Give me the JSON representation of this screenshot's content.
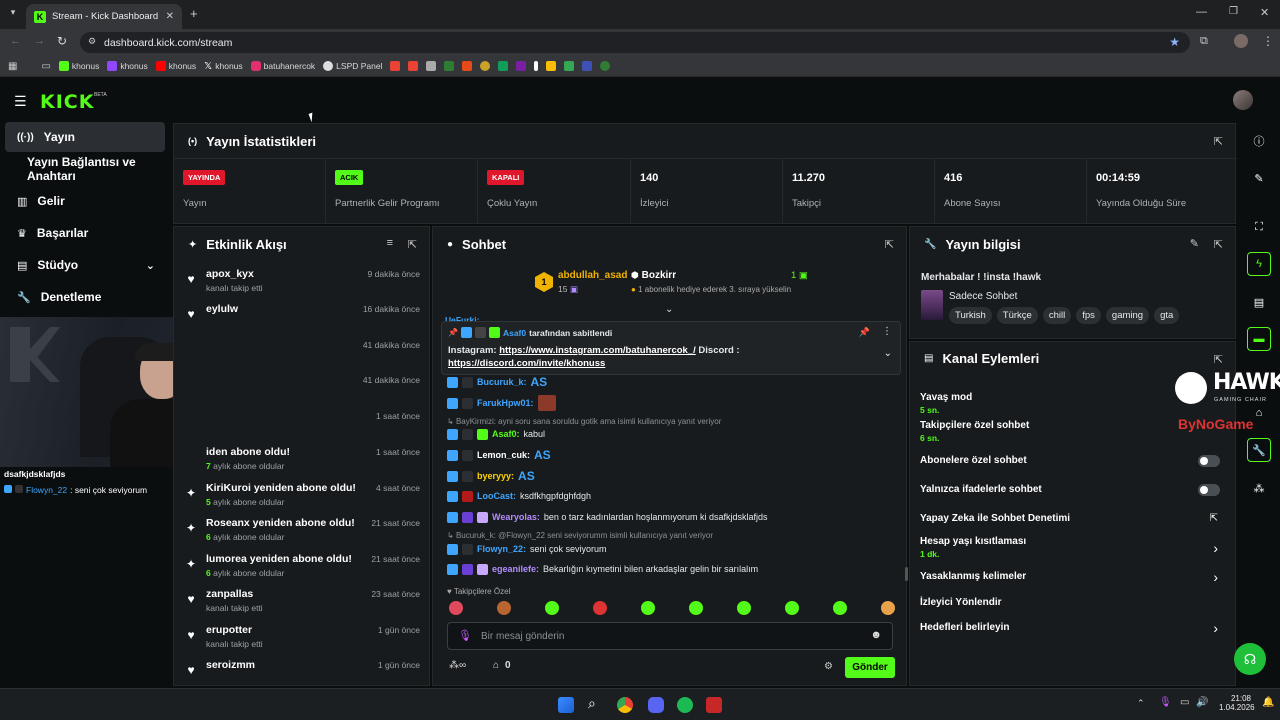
{
  "browser": {
    "tab_title": "Stream - Kick Dashboard",
    "url": "dashboard.kick.com/stream",
    "bookmarks": [
      {
        "label": "khonus",
        "color": "#53fc18"
      },
      {
        "label": "khonus",
        "color": "#9146ff"
      },
      {
        "label": "khonus",
        "color": "#ff0000"
      },
      {
        "label": "khonus",
        "color": "#ffffff"
      },
      {
        "label": "batuhanercok",
        "color": "#e1306c"
      },
      {
        "label": "LSPD Panel",
        "color": "#ffffff"
      }
    ]
  },
  "kick": {
    "logo": "KICK",
    "beta": "BETA"
  },
  "sidebar": {
    "items": [
      {
        "label": "Yayın",
        "icon": "broadcast-icon"
      },
      {
        "label": "Yayın Bağlantısı ve Anahtarı",
        "icon": ""
      },
      {
        "label": "Gelir",
        "icon": "chart-icon"
      },
      {
        "label": "Başarılar",
        "icon": "trophy-icon"
      },
      {
        "label": "Stüdyo",
        "icon": "studio-icon"
      },
      {
        "label": "Denetleme",
        "icon": "wrench-icon"
      }
    ]
  },
  "stats": {
    "title": "Yayın İstatistikleri",
    "cards": [
      {
        "badge": "YAYINDA",
        "label": "Yayın",
        "color": "#e0162b"
      },
      {
        "badge": "ACIK",
        "label": "Partnerlik Gelir Programı",
        "color": "#53fc18"
      },
      {
        "badge": "KAPALI",
        "label": "Çoklu Yayın",
        "color": "#e0162b"
      },
      {
        "value": "140",
        "label": "İzleyici"
      },
      {
        "value": "11.270",
        "label": "Takipçi"
      },
      {
        "value": "416",
        "label": "Abone Sayısı"
      },
      {
        "value": "00:14:59",
        "label": "Yayında Olduğu Süre"
      }
    ]
  },
  "activity": {
    "title": "Etkinlik Akışı",
    "items": [
      {
        "user": "apox_kyx",
        "sub": "kanalı takip etti",
        "time": "9 dakika önce",
        "icon": "♥"
      },
      {
        "user": "eylulw",
        "sub": "",
        "time": "16 dakika önce",
        "icon": "♥"
      },
      {
        "user": "",
        "sub": "",
        "time": "41 dakika önce",
        "icon": ""
      },
      {
        "user": "",
        "sub": "",
        "time": "41 dakika önce",
        "icon": ""
      },
      {
        "user": "",
        "sub": "",
        "time": "1 saat önce",
        "icon": ""
      },
      {
        "user": "iden abone oldu!",
        "sub_num": "7",
        "sub": "aylık abone oldular",
        "time": "1 saat önce",
        "icon": ""
      },
      {
        "user": "KiriKuroi yeniden abone oldu!",
        "sub_num": "5",
        "sub": "aylık abone oldular",
        "time": "4 saat önce",
        "icon": "✦"
      },
      {
        "user": "Roseanx yeniden abone oldu!",
        "sub_num": "6",
        "sub": "aylık abone oldular",
        "time": "21 saat önce",
        "icon": "✦"
      },
      {
        "user": "lumorea yeniden abone oldu!",
        "sub_num": "6",
        "sub": "aylık abone oldular",
        "time": "21 saat önce",
        "icon": "✦"
      },
      {
        "user": "zanpallas",
        "sub": "kanalı takip etti",
        "time": "23 saat önce",
        "icon": "♥"
      },
      {
        "user": "erupotter",
        "sub": "kanalı takip etti",
        "time": "1 gün önce",
        "icon": "♥"
      },
      {
        "user": "seroizmm",
        "sub": "",
        "time": "1 gün önce",
        "icon": "♥"
      }
    ]
  },
  "chat": {
    "title": "Sohbet",
    "gifter": {
      "rank": "1",
      "name": "abdullah_asad",
      "count": "15",
      "recipient": "Bozkirr",
      "recipient_count": "1",
      "note": "1 abonelik hediye ederek 3. sıraya yükselin"
    },
    "pinned": {
      "by_user": "Asaf0",
      "by_text": "tarafından sabitlendi",
      "prefix": "Instagram: ",
      "link1": "https://www.instagram.com/batuhanercok_/",
      "mid": " Discord : ",
      "link2": "https://discord.com/invite/khonuss"
    },
    "partial_user": "UeFurki:",
    "messages": [
      {
        "user": "Bucuruk_k:",
        "text": "AS",
        "color": "#3ea6ff",
        "big": true
      },
      {
        "user": "FarukHpw01:",
        "text": "",
        "color": "#3ea6ff",
        "emote": true
      },
      {
        "reply": "BayKirmizi: ayni soru sana soruldu gotik ama isimli kullanıcıya yanıt veriyor"
      },
      {
        "user": "Asaf0:",
        "text": "kabul",
        "color": "#53fc18"
      },
      {
        "user": "Lemon_cuk:",
        "text": "AS",
        "color": "#ffffff",
        "big": true
      },
      {
        "user": "byeryyy:",
        "text": "AS",
        "color": "#ffd400",
        "big": true
      },
      {
        "user": "LooCast:",
        "text": "ksdfkhgpfdghfdgh",
        "color": "#3ea6ff"
      },
      {
        "user": "Wearyolas:",
        "text": "ben o tarz kadınlardan hoşlanmıyorum ki dsafkjdsklafjds",
        "color": "#b28dff"
      },
      {
        "reply": "Bucuruk_k: @Flowyn_22 seni seviyorumm    isimli kullanıcıya yanıt veriyor"
      },
      {
        "user": "Flowyn_22:",
        "text": "seni çok seviyorum",
        "color": "#3ea6ff"
      },
      {
        "user": "egeanilefe:",
        "text": "Bekarlığın kıymetini bilen arkadaşlar gelin bir sarılalım",
        "color": "#b28dff"
      }
    ],
    "follower_only": "Takipçilere Özel",
    "input_placeholder": "Bir mesaj gönderin",
    "points": "0",
    "send": "Gönder"
  },
  "webcam_overlay": {
    "line1": "dsafkjdsklafjds",
    "user": "Flowyn_22",
    "text": ": seni çok seviyorum"
  },
  "stream_info": {
    "title": "Yayın bilgisi",
    "stream_title": "Merhabalar ! !insta !hawk",
    "category": "Sadece Sohbet",
    "tags": [
      "Turkish",
      "Türkçe",
      "chill",
      "fps",
      "gaming",
      "gta"
    ]
  },
  "actions": {
    "title": "Kanal Eylemleri",
    "items": [
      {
        "label": "Yavaş mod",
        "sub": "5 sn.",
        "control": "none"
      },
      {
        "label": "Takipçilere özel sohbet",
        "sub": "6 sn.",
        "control": "none"
      },
      {
        "label": "Abonelere özel sohbet",
        "sub": "",
        "control": "toggle"
      },
      {
        "label": "Yalnızca ifadelerle sohbet",
        "sub": "",
        "control": "toggle"
      },
      {
        "label": "Yapay Zeka ile Sohbet Denetimi",
        "sub": "",
        "control": "external"
      },
      {
        "label": "Hesap yaşı kısıtlaması",
        "sub": "1 dk.",
        "control": "chevron"
      },
      {
        "label": "Yasaklanmış kelimeler",
        "sub": "",
        "control": "chevron"
      },
      {
        "label": "İzleyici Yönlendir",
        "sub": "",
        "control": "none"
      },
      {
        "label": "Hedefleri belirleyin",
        "sub": "",
        "control": "chevron"
      }
    ]
  },
  "sponsor": {
    "name": "HAWK",
    "sub": "GAMING CHAIR",
    "second": "ByNoGame"
  },
  "taskbar": {
    "time": "21:08",
    "date": "1.04.2026"
  }
}
